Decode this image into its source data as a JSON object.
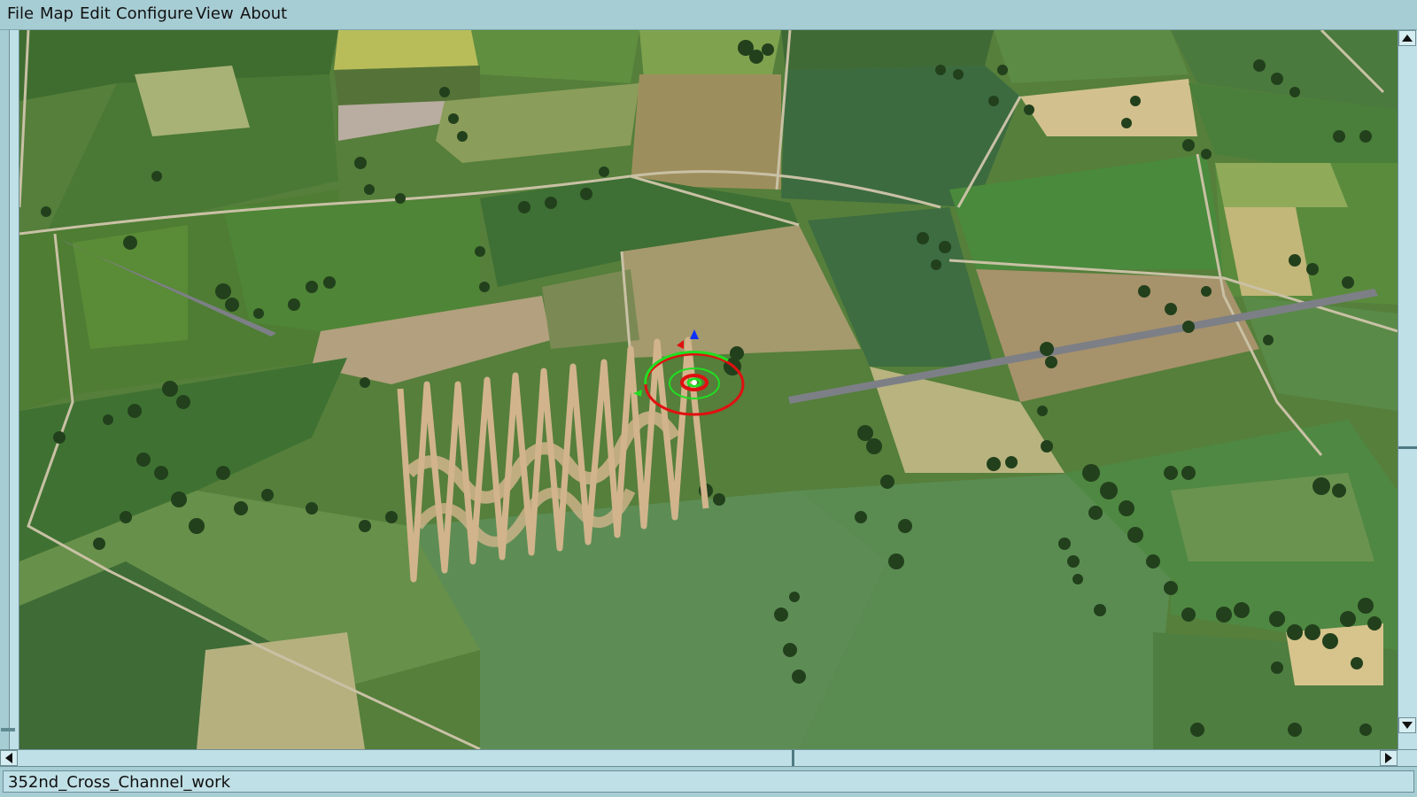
{
  "menu": {
    "items": [
      "File",
      "Map",
      "Edit",
      "Configure",
      "View",
      "About"
    ]
  },
  "status": {
    "text": "352nd_Cross_Channel_work"
  },
  "viewport": {
    "scene": "aerial-terrain-view",
    "gizmo_colors": {
      "outer_ring": "#e01010",
      "inner_ring": "#22dd22",
      "center": "#ffffff",
      "axis_z": "#1030ff"
    },
    "road_color": "#7d7f86",
    "object_color": "#d2b48c"
  },
  "scrollbars": {
    "horizontal_position_percent": 56,
    "vertical_position_percent": 58
  }
}
